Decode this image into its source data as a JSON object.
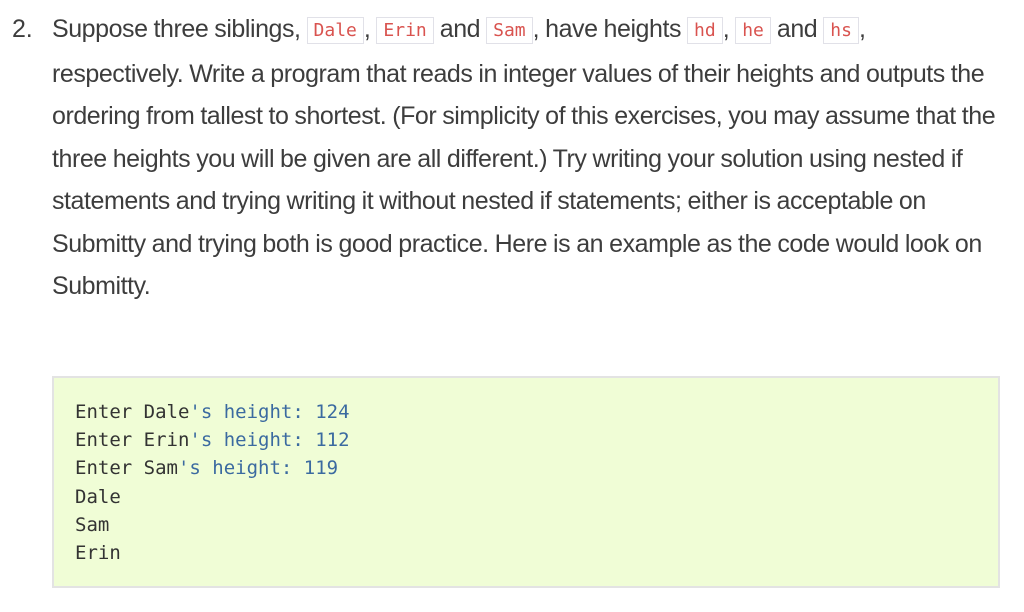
{
  "question": {
    "number": "2.",
    "segments": [
      {
        "type": "text",
        "value": "Suppose three siblings, "
      },
      {
        "type": "code",
        "value": "Dale"
      },
      {
        "type": "text",
        "value": ", "
      },
      {
        "type": "code",
        "value": "Erin"
      },
      {
        "type": "text",
        "value": " and "
      },
      {
        "type": "code",
        "value": "Sam"
      },
      {
        "type": "text",
        "value": ", have heights "
      },
      {
        "type": "code",
        "value": "hd"
      },
      {
        "type": "text",
        "value": ", "
      },
      {
        "type": "code",
        "value": "he"
      },
      {
        "type": "text",
        "value": " and "
      },
      {
        "type": "code",
        "value": "hs"
      },
      {
        "type": "text",
        "value": ", respectively. Write a program that reads in integer values of their heights and outputs the ordering from tallest to shortest. (For simplicity of this exercises, you may assume that the three heights you will be given are all different.) Try writing your solution using nested if statements and trying writing it without nested if statements; either is acceptable on Submitty and trying both is good practice. Here is an example as the code would look on Submitty."
      }
    ]
  },
  "example_output": {
    "lines": [
      [
        {
          "style": "plain",
          "value": "Enter Dale"
        },
        {
          "style": "string",
          "value": "'s height: 124"
        }
      ],
      [
        {
          "style": "plain",
          "value": "Enter Erin"
        },
        {
          "style": "string",
          "value": "'s height: 112"
        }
      ],
      [
        {
          "style": "plain",
          "value": "Enter Sam"
        },
        {
          "style": "string",
          "value": "'s height: 119"
        }
      ],
      [
        {
          "style": "plain",
          "value": "Dale"
        }
      ],
      [
        {
          "style": "plain",
          "value": "Sam"
        }
      ],
      [
        {
          "style": "plain",
          "value": "Erin"
        }
      ]
    ],
    "colors": {
      "plain": "#333333",
      "string": "#3b6aa0",
      "background": "#f0fdd6",
      "inline_code": "#d9534f"
    }
  }
}
